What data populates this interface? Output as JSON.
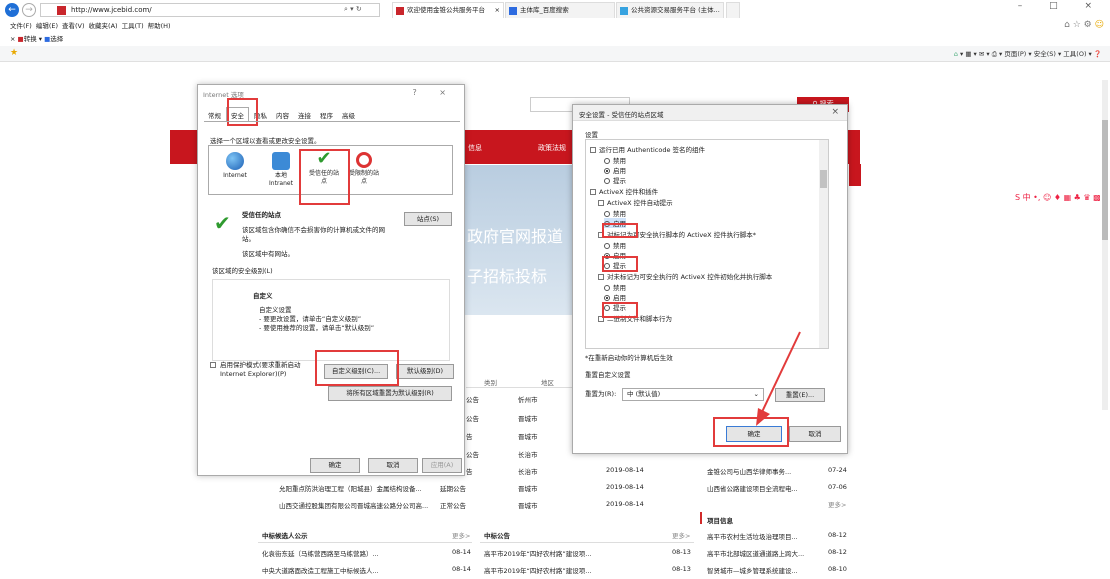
{
  "browser": {
    "url": "http://www.jcebid.com/",
    "search_icons": "⌕ ▾ ↻",
    "tabs": [
      "欢迎使用金锥公共服务平台",
      "主体库_百度搜索",
      "公共资源交易服务平台 (主体..."
    ],
    "tab_close": "×",
    "window_controls": "– □ ×",
    "menu": [
      "文件(F)",
      "编辑(E)",
      "查看(V)",
      "收藏夹(A)",
      "工具(T)",
      "帮助(H)"
    ],
    "favbar": [
      "×",
      "转换",
      "▾",
      "选择"
    ],
    "cmdbar": "页面(P) ▾   安全(S) ▾   工具(O) ▾",
    "accent": "#1f6fd6"
  },
  "page": {
    "search_label": "搜索",
    "nav": [
      "信息",
      "政策法规"
    ],
    "banner_lines": [
      "政府官网报道",
      "子招标投标"
    ],
    "table_headers": [
      "类别",
      "地区"
    ],
    "rows": [
      {
        "cat": "公告",
        "area": "忻州市"
      },
      {
        "cat": "公告",
        "area": "晋城市"
      },
      {
        "cat": "告",
        "area": "晋城市"
      },
      {
        "cat": "公告",
        "area": "长治市"
      },
      {
        "cat": "告",
        "area": "长治市",
        "date": "2019-08-14"
      },
      {
        "title": "允阳重点防洪治理工程（阳城县）金属结构设备...",
        "cat": "延期公告",
        "area": "晋城市",
        "date": "2019-08-14"
      },
      {
        "title": "山西交通控股集团有限公司晋城高速公路分公司高...",
        "cat": "正常公告",
        "area": "晋城市",
        "date": "2019-08-14"
      }
    ],
    "right_list": [
      {
        "t": "金锥公司与山西华律师事务...",
        "d": "07-24"
      },
      {
        "t": "山西省公路建设项目全流程电...",
        "d": "07-06"
      }
    ],
    "more": "更多>",
    "bottom": {
      "col1": {
        "title": "中标候选人公示",
        "items": [
          {
            "t": "化袁街东延（马练营西路至马练营路）...",
            "d": "08-14"
          },
          {
            "t": "中央大道路面改造工程施工中标候选人...",
            "d": "08-14"
          }
        ]
      },
      "col2": {
        "title": "中标公告",
        "items": [
          {
            "t": "高平市2019年“四好农村路”建设项...",
            "d": "08-13"
          },
          {
            "t": "高平市2019年“四好农村路”建设项...",
            "d": "08-13"
          }
        ]
      },
      "col3": {
        "title": "项目信息",
        "items": [
          {
            "t": "高平市农村生活垃圾治理项目...",
            "d": "08-12"
          },
          {
            "t": "高平市北部城区道通道路上跨大...",
            "d": "08-12"
          },
          {
            "t": "智贤城市—城乡管理系统建设...",
            "d": "08-10"
          }
        ]
      }
    },
    "brand_color": "#c8161e"
  },
  "dlg1": {
    "title": "Internet 选项",
    "controls": "? ×",
    "tabs": [
      "常规",
      "安全",
      "隐私",
      "内容",
      "连接",
      "程序",
      "高级"
    ],
    "zone_prompt": "选择一个区域以查看或更改安全设置。",
    "zones": [
      {
        "l1": "Internet",
        "l2": ""
      },
      {
        "l1": "本地",
        "l2": "Intranet"
      },
      {
        "l1": "受信任的站",
        "l2": "点"
      },
      {
        "l1": "受限制的站",
        "l2": "点"
      }
    ],
    "zone_name": "受信任的站点",
    "zone_desc1": "该区域包含你确信不会损害你的计算机或文件的网",
    "zone_desc2": "站。",
    "zone_desc3": "该区域中有网站。",
    "sites_btn": "站点(S)",
    "level_label": "该区域的安全级别(L)",
    "custom": "自定义",
    "custom_l1": "自定义设置",
    "custom_l2": "- 要更改设置，请单击“自定义级别”",
    "custom_l3": "- 要使用推荐的设置，请单击“默认级别”",
    "protect1": "启用保护模式(要求重新启动",
    "protect2": "Internet Explorer)(P)",
    "btn_custom": "自定义级别(C)...",
    "btn_default": "默认级别(D)",
    "btn_reset_all": "将所有区域重置为默认级别(R)",
    "ok": "确定",
    "cancel": "取消",
    "apply": "应用(A)"
  },
  "dlg2": {
    "title": "安全设置 - 受信任的站点区域",
    "close": "×",
    "settings_label": "设置",
    "items": [
      {
        "kind": "chk",
        "text": "运行已用 Authenticode 签名的组件"
      },
      {
        "kind": "radio",
        "on": false,
        "text": "禁用"
      },
      {
        "kind": "radio",
        "on": true,
        "text": "启用"
      },
      {
        "kind": "radio",
        "on": false,
        "text": "提示"
      },
      {
        "kind": "chk",
        "text": "ActiveX 控件和插件"
      },
      {
        "kind": "chk",
        "text": "ActiveX 控件自动提示"
      },
      {
        "kind": "radio",
        "on": false,
        "text": "禁用"
      },
      {
        "kind": "radio",
        "on": true,
        "text": "启用"
      },
      {
        "kind": "chk",
        "text": "对标记为可安全执行脚本的 ActiveX 控件执行脚本*"
      },
      {
        "kind": "radio",
        "on": false,
        "text": "禁用"
      },
      {
        "kind": "radio",
        "on": true,
        "text": "启用"
      },
      {
        "kind": "radio",
        "on": false,
        "text": "提示"
      },
      {
        "kind": "chk",
        "text": "对未标记为可安全执行的 ActiveX 控件初始化并执行脚本"
      },
      {
        "kind": "radio",
        "on": false,
        "text": "禁用"
      },
      {
        "kind": "radio",
        "on": true,
        "text": "启用"
      },
      {
        "kind": "radio",
        "on": false,
        "text": "提示"
      },
      {
        "kind": "chk",
        "text": "二进制文件和脚本行为"
      }
    ],
    "note": "*在重新启动你的计算机后生效",
    "reset_group": "重置自定义设置",
    "reset_to": "重置为(R):",
    "reset_value": "中 (默认值)",
    "reset_btn": "重置(E)...",
    "ok": "确定",
    "cancel": "取消"
  },
  "annotation_color": "#e23b3b"
}
